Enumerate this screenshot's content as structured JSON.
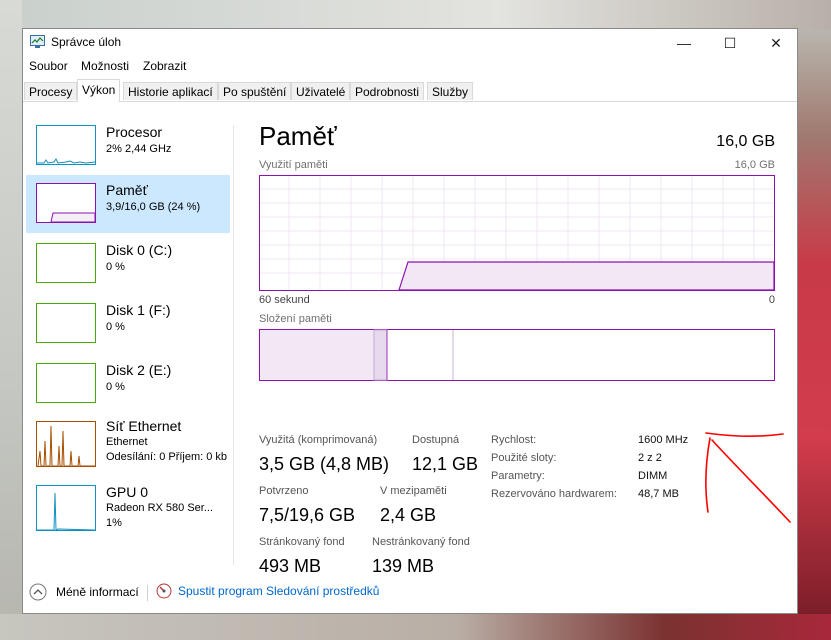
{
  "window": {
    "title": "Správce úloh",
    "controls": {
      "minimize": "—",
      "maximize": "☐",
      "close": "✕"
    }
  },
  "menu": [
    "Soubor",
    "Možnosti",
    "Zobrazit"
  ],
  "tabs": [
    "Procesy",
    "Výkon",
    "Historie aplikací",
    "Po spuštění",
    "Uživatelé",
    "Podrobnosti",
    "Služby"
  ],
  "sidebar": {
    "items": [
      {
        "title": "Procesor",
        "line1": "2% 2,44 GHz",
        "line2": "",
        "line3": ""
      },
      {
        "title": "Paměť",
        "line1": "3,9/16,0 GB (24 %)",
        "line2": "",
        "line3": ""
      },
      {
        "title": "Disk 0 (C:)",
        "line1": "0 %",
        "line2": "",
        "line3": ""
      },
      {
        "title": "Disk 1 (F:)",
        "line1": "0 %",
        "line2": "",
        "line3": ""
      },
      {
        "title": "Disk 2 (E:)",
        "line1": "0 %",
        "line2": "",
        "line3": ""
      },
      {
        "title": "Síť Ethernet",
        "line1": "Ethernet",
        "line2": "Odesílání: 0 Příjem: 0 kb",
        "line3": ""
      },
      {
        "title": "GPU 0",
        "line1": "Radeon RX 580 Ser...",
        "line2": "1%",
        "line3": ""
      }
    ]
  },
  "main": {
    "title": "Paměť",
    "total": "16,0 GB",
    "usage_label": "Využití paměti",
    "usage_max": "16,0 GB",
    "time_label": "60 sekund",
    "time_min": "0",
    "composition_label": "Složení paměti",
    "stats": {
      "used_label": "Využitá (komprimovaná)",
      "used_value": "3,5 GB (4,8 MB)",
      "avail_label": "Dostupná",
      "avail_value": "12,1 GB",
      "committed_label": "Potvrzeno",
      "committed_value": "7,5/19,6 GB",
      "cached_label": "V mezipaměti",
      "cached_value": "2,4 GB",
      "paged_label": "Stránkovaný fond",
      "paged_value": "493 MB",
      "nonpaged_label": "Nestránkovaný fond",
      "nonpaged_value": "139 MB"
    },
    "details": {
      "speed_label": "Rychlost:",
      "speed_value": "1600 MHz",
      "slots_label": "Použité sloty:",
      "slots_value": "2 z 2",
      "form_label": "Parametry:",
      "form_value": "DIMM",
      "reserved_label": "Rezervováno hardwarem:",
      "reserved_value": "48,7 MB"
    }
  },
  "footer": {
    "less_info": "Méně informací",
    "resmon": "Spustit program Sledování prostředků"
  },
  "colors": {
    "memory": "#8b12ae",
    "cpu": "#1191c1",
    "disk": "#4da60c",
    "net": "#a74f01",
    "selected": "#cce8ff",
    "link": "#0066cc",
    "annotation": "#ff0000"
  }
}
